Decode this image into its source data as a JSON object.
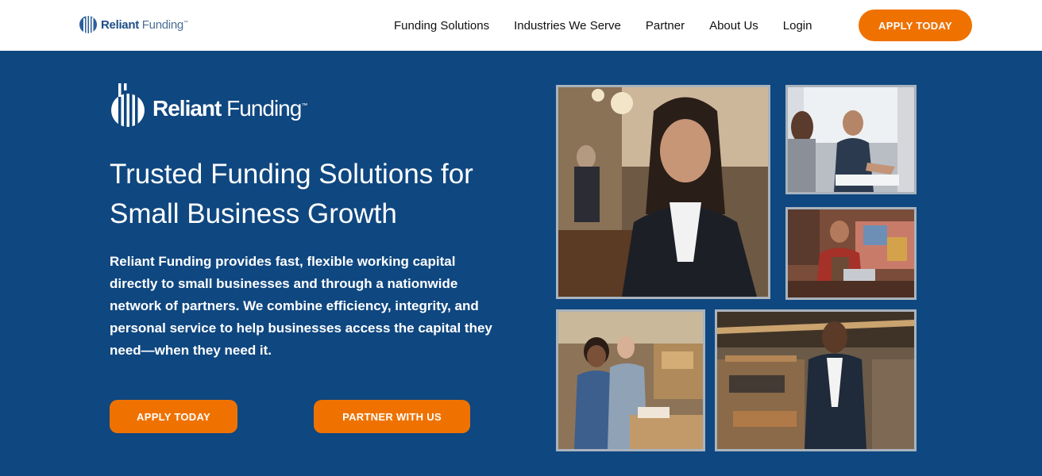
{
  "nav": {
    "logo": {
      "bold": "Reliant",
      "light": "Funding",
      "tm": "™"
    },
    "links": [
      {
        "label": "Funding Solutions"
      },
      {
        "label": "Industries We Serve"
      },
      {
        "label": "Partner"
      },
      {
        "label": "About Us"
      },
      {
        "label": "Login"
      }
    ],
    "cta": "APPLY TODAY"
  },
  "hero": {
    "logo": {
      "bold": "Reliant",
      "light": "Funding",
      "tm": "™"
    },
    "title": "Trusted Funding Solutions for Small Business Growth",
    "description": "Reliant Funding provides fast, flexible working capital directly to small businesses and through a nationwide network of partners. We combine efficiency, integrity, and personal service to help businesses access the capital they need—when they need it.",
    "buttons": {
      "apply": "APPLY TODAY",
      "partner": "PARTNER WITH US"
    }
  },
  "photos": [
    {
      "name": "photo-businesswoman-courtroom"
    },
    {
      "name": "photo-handshake-office"
    },
    {
      "name": "photo-shop-owner-tablet"
    },
    {
      "name": "photo-couple-warehouse"
    },
    {
      "name": "photo-businessman-workshop"
    }
  ],
  "colors": {
    "brand_blue": "#0f4780",
    "accent_orange": "#ef7200",
    "nav_bg": "#ffffff",
    "photo_border": "#a9b3bd"
  }
}
